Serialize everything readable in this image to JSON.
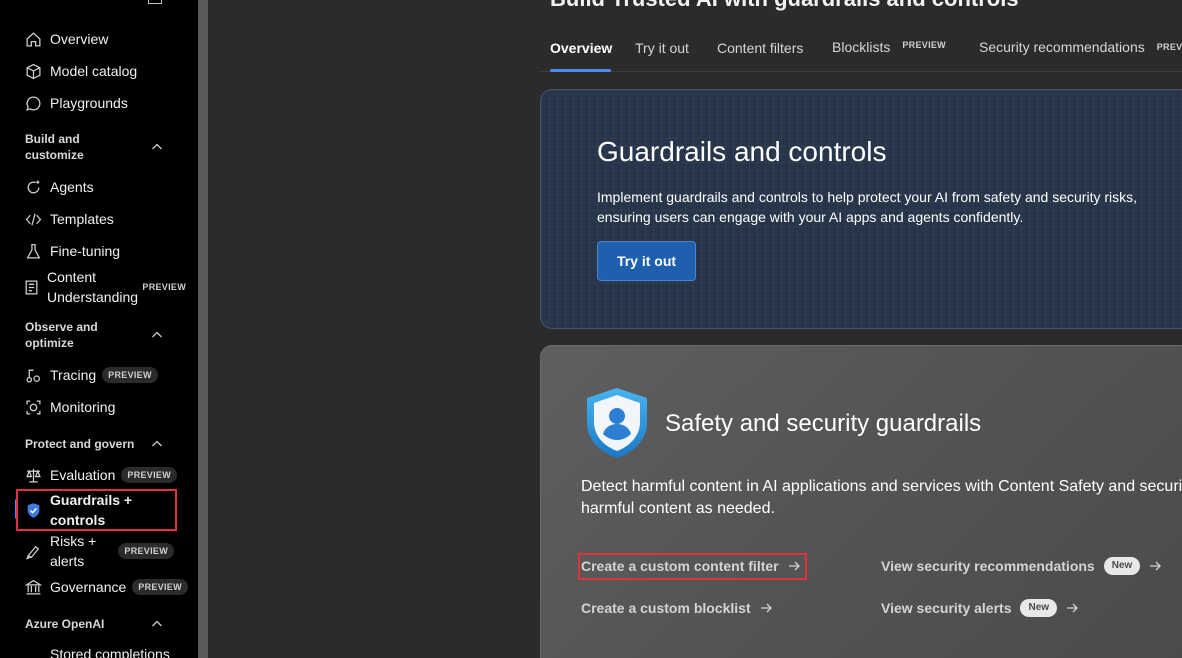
{
  "sidebar": {
    "items": [
      {
        "label": "Overview",
        "icon": "home-icon"
      },
      {
        "label": "Model catalog",
        "icon": "cube-icon"
      },
      {
        "label": "Playgrounds",
        "icon": "chat-icon"
      },
      {
        "label": "Agents",
        "icon": "agent-icon"
      },
      {
        "label": "Templates",
        "icon": "code-icon"
      },
      {
        "label": "Fine-tuning",
        "icon": "flask-icon"
      },
      {
        "label": "Content Understanding",
        "icon": "document-icon",
        "badge": "PREVIEW"
      },
      {
        "label": "Tracing",
        "icon": "tracing-icon",
        "badge": "PREVIEW"
      },
      {
        "label": "Monitoring",
        "icon": "camera-icon"
      },
      {
        "label": "Evaluation",
        "icon": "scale-icon",
        "badge": "PREVIEW"
      },
      {
        "label": "Guardrails + controls",
        "icon": "shield-icon",
        "selected": true
      },
      {
        "label": "Risks + alerts",
        "icon": "alert-icon",
        "badge": "PREVIEW"
      },
      {
        "label": "Governance",
        "icon": "building-icon",
        "badge": "PREVIEW"
      },
      {
        "label": "Stored completions",
        "icon": ""
      }
    ],
    "sections": [
      {
        "label": "Build and customize"
      },
      {
        "label": "Observe and optimize"
      },
      {
        "label": "Protect and govern"
      },
      {
        "label": "Azure OpenAI"
      }
    ]
  },
  "main": {
    "page_title": "Build Trusted AI with guardrails and controls",
    "tabs": [
      {
        "label": "Overview",
        "active": true
      },
      {
        "label": "Try it out"
      },
      {
        "label": "Content filters"
      },
      {
        "label": "Blocklists",
        "badge": "PREVIEW"
      },
      {
        "label": "Security recommendations",
        "badge": "PREVIEW"
      }
    ],
    "hero": {
      "title": "Guardrails and controls",
      "description": "Implement guardrails and controls to help protect your AI from safety and security risks, ensuring users can engage with your AI apps and agents confidently.",
      "button": "Try it out"
    },
    "safety": {
      "title": "Safety and security guardrails",
      "description": "Detect harmful content in AI applications and services with Content Safety and security harmful content as needed.",
      "links": [
        {
          "label": "Create a custom content filter"
        },
        {
          "label": "Create a custom blocklist"
        },
        {
          "label": "View security recommendations",
          "pill": "New"
        },
        {
          "label": "View security alerts",
          "pill": "New"
        }
      ]
    }
  },
  "colors": {
    "accent": "#4f8ae8",
    "highlight": "#e0313c",
    "primary_button": "#1e5fae"
  }
}
